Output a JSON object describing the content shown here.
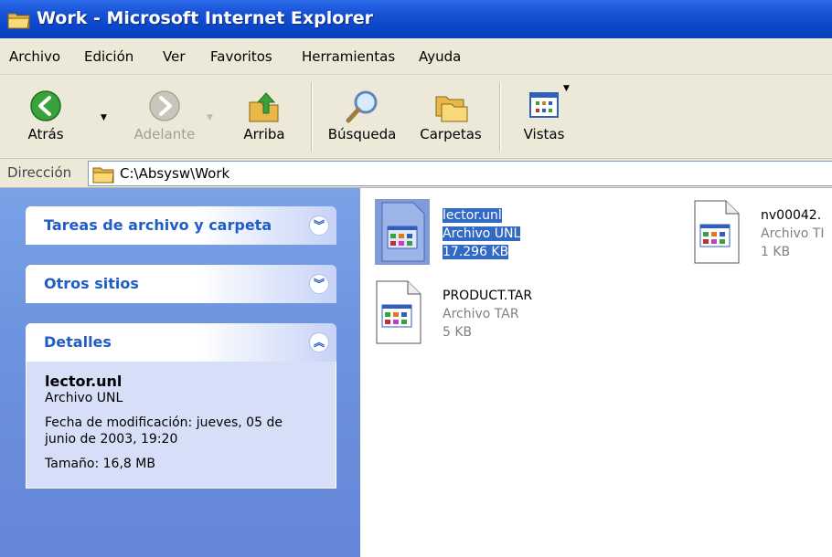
{
  "window": {
    "title": "Work - Microsoft Internet Explorer"
  },
  "menu": [
    "Archivo",
    "Edición",
    "Ver",
    "Favoritos",
    "Herramientas",
    "Ayuda"
  ],
  "toolbar": {
    "back": "Atrás",
    "forward": "Adelante",
    "up": "Arriba",
    "search": "Búsqueda",
    "folders": "Carpetas",
    "views": "Vistas"
  },
  "address": {
    "label": "Dirección",
    "value": "C:\\Absysw\\Work"
  },
  "taskpane": {
    "file_tasks": "Tareas de archivo y carpeta",
    "other_places": "Otros sitios",
    "details": {
      "title": "Detalles",
      "name": "lector.unl",
      "type": "Archivo UNL",
      "modified": "Fecha de modificación: jueves, 05 de junio de 2003, 19:20",
      "size": "Tamaño: 16,8 MB"
    }
  },
  "files": [
    {
      "name": "lector.unl",
      "type": "Archivo UNL",
      "size": "17.296 KB",
      "selected": true
    },
    {
      "name": "nv00042.",
      "type": "Archivo TI",
      "size": "1 KB",
      "selected": false
    },
    {
      "name": "PRODUCT.TAR",
      "type": "Archivo TAR",
      "size": "5 KB",
      "selected": false
    }
  ],
  "colors": {
    "titlebar": "#0b46c8",
    "taskpane": "#6d93de",
    "selection": "#316ac5"
  }
}
